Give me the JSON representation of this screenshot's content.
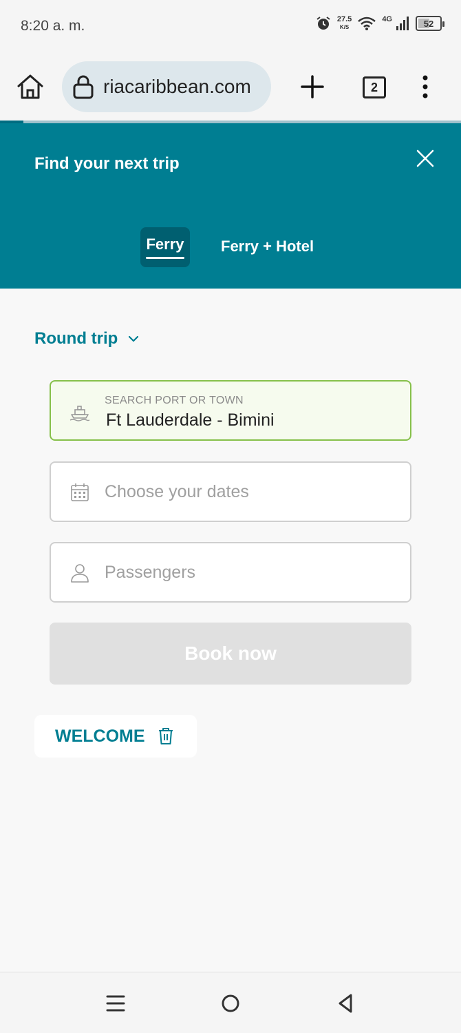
{
  "status_bar": {
    "time": "8:20 a. m.",
    "network_speed": "27.5",
    "network_speed_unit": "K/S",
    "signal_type": "4G",
    "battery": "52",
    "icons": [
      "alarm-icon",
      "wifi-icon",
      "signal-icon",
      "battery-icon"
    ]
  },
  "browser": {
    "url": "riacaribbean.com",
    "tab_count": "2",
    "icons": [
      "home-icon",
      "lock-icon",
      "plus-icon",
      "menu-dots-icon"
    ]
  },
  "header": {
    "title": "Find your next trip",
    "tabs": [
      {
        "label": "Ferry",
        "active": true
      },
      {
        "label": "Ferry + Hotel",
        "active": false
      }
    ]
  },
  "form": {
    "trip_type": "Round trip",
    "port_label": "SEARCH PORT OR TOWN",
    "port_value": "Ft Lauderdale - Bimini",
    "dates_placeholder": "Choose your dates",
    "passengers_placeholder": "Passengers",
    "book_label": "Book now"
  },
  "promo": {
    "code": "WELCOME"
  },
  "colors": {
    "brand_teal": "#007e92",
    "tab_active_bg": "#005f70",
    "port_border": "#86c04a",
    "button_disabled": "#e0e0e0"
  }
}
